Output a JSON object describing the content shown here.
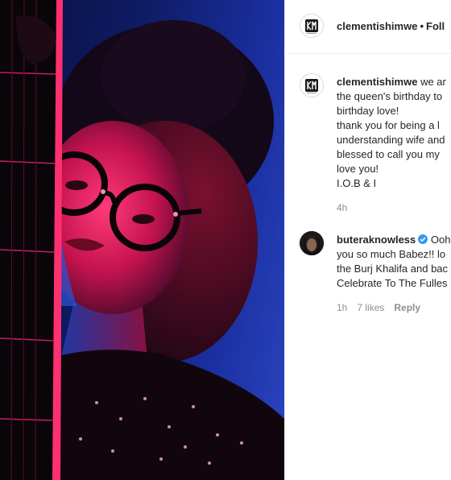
{
  "post": {
    "username": "clementishimwe",
    "separator": "•",
    "follow_label": "Foll"
  },
  "caption": {
    "username": "clementishimwe",
    "lines": [
      "we ar",
      "the queen's birthday to",
      "birthday love!",
      "thank you for being a l",
      "understanding wife and",
      "blessed to call you my",
      "love you!",
      "I.O.B & I"
    ],
    "time": "4h"
  },
  "comments": [
    {
      "username": "buteraknowless",
      "verified": true,
      "lines": [
        "Ooh",
        "you so much Babez!! lo",
        "the Burj Khalifa and bac",
        "Celebrate To The Fulles"
      ],
      "time": "1h",
      "likes": "7 likes",
      "reply_label": "Reply"
    }
  ],
  "colors": {
    "verified": "#3897f0",
    "meta_text": "#8e8e8e",
    "photo_bg": "#0e1c66",
    "magenta_light": "#ff2a6a"
  },
  "icons": {
    "logo": "km-monogram-logo",
    "verified": "verified-badge-icon"
  }
}
